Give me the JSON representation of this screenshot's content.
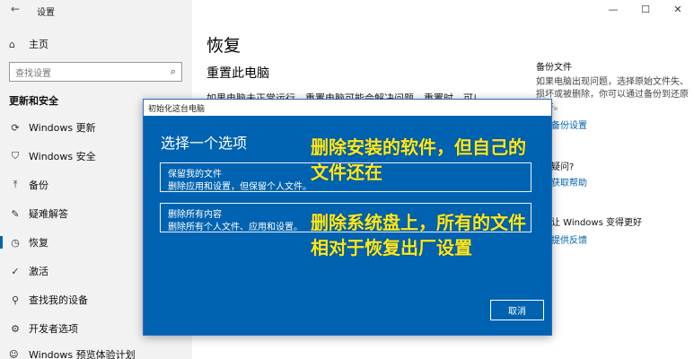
{
  "app": {
    "title": "设置"
  },
  "window_controls": [
    "—",
    "☐",
    "✕"
  ],
  "sidebar": {
    "home_label": "主页",
    "search_placeholder": "查找设置",
    "section_heading": "更新和安全",
    "items": [
      {
        "label": "Windows 更新",
        "icon": "sync-icon"
      },
      {
        "label": "Windows 安全",
        "icon": "shield-icon"
      },
      {
        "label": "备份",
        "icon": "upload-icon"
      },
      {
        "label": "疑难解答",
        "icon": "wrench-icon"
      },
      {
        "label": "恢复",
        "icon": "history-icon"
      },
      {
        "label": "激活",
        "icon": "check-circle-icon"
      },
      {
        "label": "查找我的设备",
        "icon": "person-pin-icon"
      },
      {
        "label": "开发者选项",
        "icon": "sliders-icon"
      },
      {
        "label": "Windows 预览体验计划",
        "icon": "smile-icon"
      }
    ]
  },
  "main": {
    "title": "恢复",
    "subtitle": "重置此电脑",
    "description": "如果电脑未正常运行，重置电脑可能会解决问题。重置时，可以选"
  },
  "right_column": {
    "backup_heading": "备份文件",
    "backup_text": "如果电脑出现问题，选择原始文件失、损坏或被删除，你可以通过备份到还原文件。",
    "backup_link": "备份设置",
    "question": "疑问?",
    "help_link": "获取帮助",
    "better_heading": "让 Windows 变得更好",
    "feedback_link": "提供反馈"
  },
  "dialog": {
    "titlebar": "初始化这台电脑",
    "heading": "选择一个选项",
    "options": [
      {
        "title": "保留我的文件",
        "desc": "删除应用和设置，但保留个人文件。"
      },
      {
        "title": "删除所有内容",
        "desc": "删除所有个人文件、应用和设置。"
      }
    ],
    "cancel_label": "取消"
  },
  "annotations": {
    "first_line1": "删除安装的软件，但自己的",
    "first_line2": "文件还在",
    "second_line1": "删除系统盘上，所有的文件",
    "second_line2": "相对于恢复出厂设置"
  },
  "colors": {
    "accent": "#0063b1",
    "annotation": "#ffe81a",
    "sidebar_bg": "#f2f2f2"
  }
}
